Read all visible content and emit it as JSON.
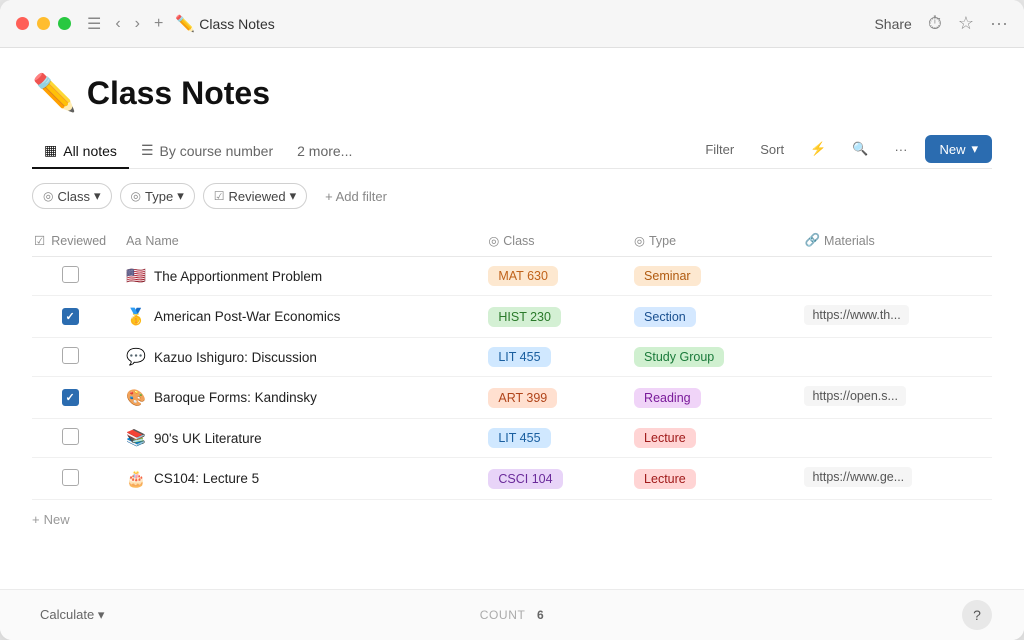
{
  "window": {
    "title": "Class Notes",
    "title_icon": "✏️"
  },
  "titlebar": {
    "nav_back": "‹",
    "nav_forward": "›",
    "add": "+",
    "share_label": "Share",
    "more_icon": "···"
  },
  "page": {
    "emoji": "✏️",
    "title": "Class Notes"
  },
  "tabs": [
    {
      "id": "all-notes",
      "icon": "▦",
      "label": "All notes",
      "active": true
    },
    {
      "id": "by-course",
      "icon": "☰",
      "label": "By course number",
      "active": false
    },
    {
      "id": "more",
      "label": "2 more...",
      "active": false
    }
  ],
  "toolbar": {
    "filter_label": "Filter",
    "sort_label": "Sort",
    "lightning_icon": "⚡",
    "search_icon": "🔍",
    "more_icon": "···",
    "new_label": "New",
    "new_chevron": "▾"
  },
  "filters": [
    {
      "id": "class-filter",
      "icon": "◎",
      "label": "Class",
      "has_chevron": true
    },
    {
      "id": "type-filter",
      "icon": "◎",
      "label": "Type",
      "has_chevron": true
    },
    {
      "id": "reviewed-filter",
      "icon": "☑",
      "label": "Reviewed",
      "has_chevron": true
    }
  ],
  "add_filter_label": "+ Add filter",
  "table": {
    "columns": [
      {
        "id": "reviewed",
        "icon": "☑",
        "label": "Reviewed"
      },
      {
        "id": "name",
        "icon": "Aa",
        "label": "Name"
      },
      {
        "id": "class",
        "icon": "◎",
        "label": "Class"
      },
      {
        "id": "type",
        "icon": "◎",
        "label": "Type"
      },
      {
        "id": "materials",
        "icon": "🔗",
        "label": "Materials"
      }
    ],
    "rows": [
      {
        "id": 1,
        "reviewed": false,
        "emoji": "🇺🇸",
        "name": "The Apportionment Problem",
        "class": "MAT 630",
        "class_style": "mat",
        "type": "Seminar",
        "type_style": "seminar",
        "materials": ""
      },
      {
        "id": 2,
        "reviewed": true,
        "emoji": "🥇",
        "name": "American Post-War Economics",
        "class": "HIST 230",
        "class_style": "hist",
        "type": "Section",
        "type_style": "section",
        "materials": "https://www.th..."
      },
      {
        "id": 3,
        "reviewed": false,
        "emoji": "💬",
        "name": "Kazuo Ishiguro: Discussion",
        "class": "LIT 455",
        "class_style": "lit",
        "type": "Study Group",
        "type_style": "studygroup",
        "materials": ""
      },
      {
        "id": 4,
        "reviewed": true,
        "emoji": "🎨",
        "name": "Baroque Forms: Kandinsky",
        "class": "ART 399",
        "class_style": "art",
        "type": "Reading",
        "type_style": "reading",
        "materials": "https://open.s..."
      },
      {
        "id": 5,
        "reviewed": false,
        "emoji": "📚",
        "name": "90's UK Literature",
        "class": "LIT 455",
        "class_style": "lit",
        "type": "Lecture",
        "type_style": "lecture",
        "materials": ""
      },
      {
        "id": 6,
        "reviewed": false,
        "emoji": "🎂",
        "name": "CS104: Lecture 5",
        "class": "CSCI 104",
        "class_style": "csci",
        "type": "Lecture",
        "type_style": "lecture",
        "materials": "https://www.ge..."
      }
    ]
  },
  "footer": {
    "new_row_label": "New",
    "calculate_label": "Calculate",
    "count_label": "COUNT",
    "count_value": "6",
    "help_label": "?"
  }
}
